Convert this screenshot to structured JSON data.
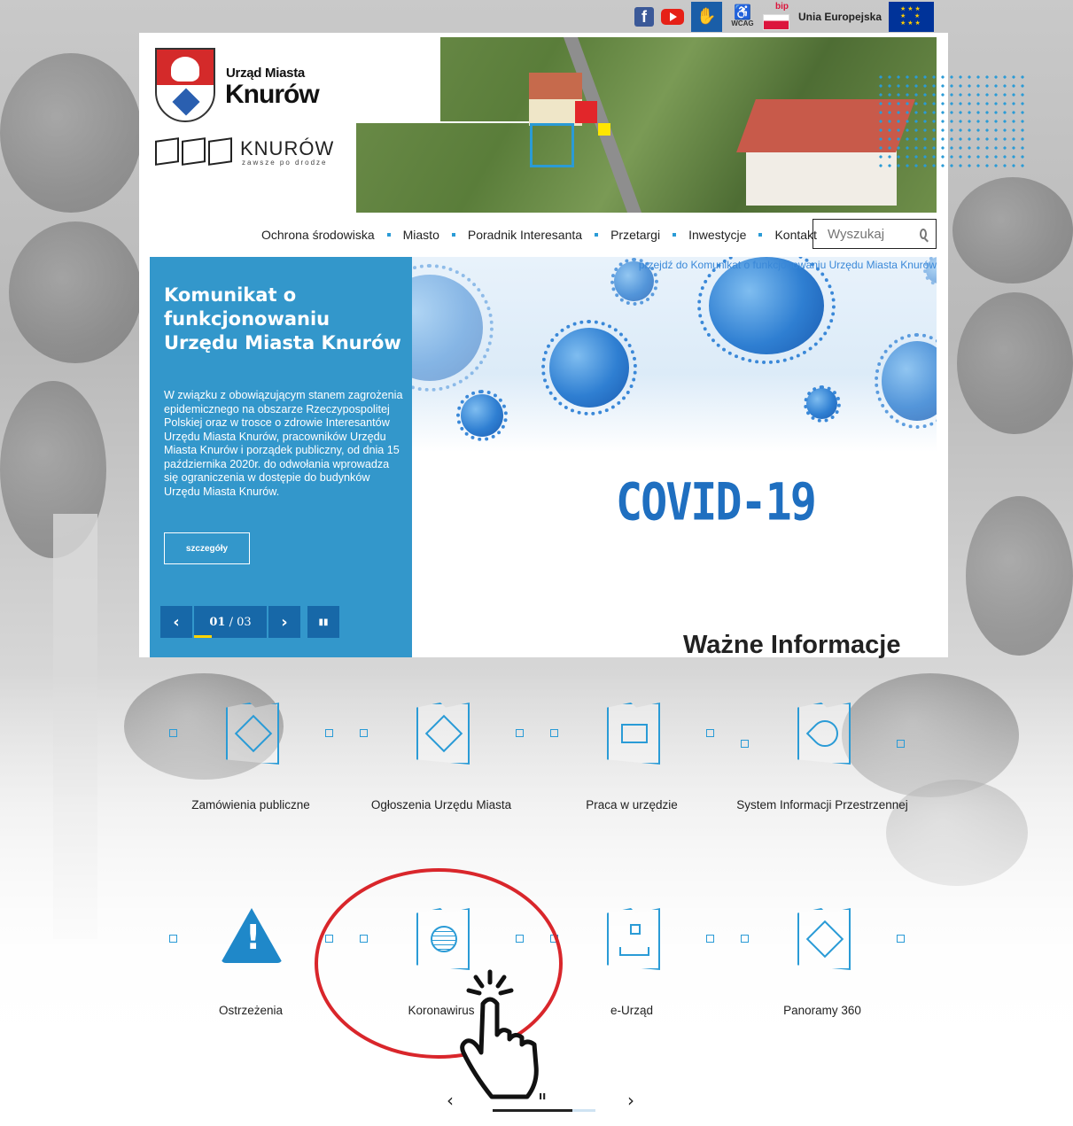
{
  "utility": {
    "facebook_icon": "facebook-icon",
    "youtube_icon": "youtube-icon",
    "sign_language_icon": "sign-language-icon",
    "wcag_label": "WCAG",
    "bip_label": "bip",
    "ue_label": "Unia Europejska"
  },
  "logo": {
    "sub": "Urząd Miasta",
    "main": "Knurów",
    "brand": "KNURÓW",
    "tagline": "zawsze po drodze"
  },
  "nav": {
    "items": [
      {
        "label": "Ochrona środowiska"
      },
      {
        "label": "Miasto"
      },
      {
        "label": "Poradnik Interesanta"
      },
      {
        "label": "Przetargi"
      },
      {
        "label": "Inwestycje"
      },
      {
        "label": "Kontakt"
      }
    ],
    "search_placeholder": "Wyszukaj"
  },
  "slider": {
    "title": "Komunikat o funkcjonowaniu Urzędu Miasta Knurów",
    "text": "W związku z obowiązującym stanem zagrożenia epidemicznego na obszarze Rzeczypospolitej Polskiej oraz w trosce o zdrowie Interesantów Urzędu Miasta Knurów, pracowników Urzędu Miasta Knurów i porządek publiczny, od dnia 15 października 2020r. do odwołania wprowadza się ograniczenia w dostępie do budynków Urzędu Miasta Knurów.",
    "details_label": "szczegóły",
    "current": "01",
    "total": "03",
    "progress": 0.33,
    "prev_icon": "chevron-left-icon",
    "next_icon": "chevron-right-icon",
    "pause_icon": "pause-icon",
    "link_text": "przejdź do Komunikat o funkcjonowaniu Urzędu Miasta Knurów",
    "image_caption": "COVID-19"
  },
  "section_title": "Ważne Informacje",
  "tiles": [
    {
      "label": "Zamówienia publiczne",
      "icon": "handshake-document-icon"
    },
    {
      "label": "Ogłoszenia Urzędu Miasta",
      "icon": "ruler-document-icon"
    },
    {
      "label": "Praca w urzędzie",
      "icon": "briefcase-icon"
    },
    {
      "label": "System Informacji Przestrzennej",
      "icon": "map-pin-icon"
    },
    {
      "label": "Ostrzeżenia",
      "icon": "warning-icon"
    },
    {
      "label": "Koronawirus",
      "icon": "globe-icon"
    },
    {
      "label": "e-Urząd",
      "icon": "org-chart-icon"
    },
    {
      "label": "Panoramy 360",
      "icon": "compass-icon"
    }
  ],
  "tiles_pager": {
    "prev_icon": "chevron-left-icon",
    "next_icon": "chevron-right-icon",
    "pause_icon": "pause-icon",
    "progress": 0.78
  },
  "annotation": {
    "highlight_color": "#d9262b",
    "cursor_icon": "hand-pointer-icon"
  },
  "colors": {
    "accent": "#2a9bd6",
    "panel": "#3397cb",
    "panel_dark": "#1768a8",
    "progress": "#ffd400"
  }
}
